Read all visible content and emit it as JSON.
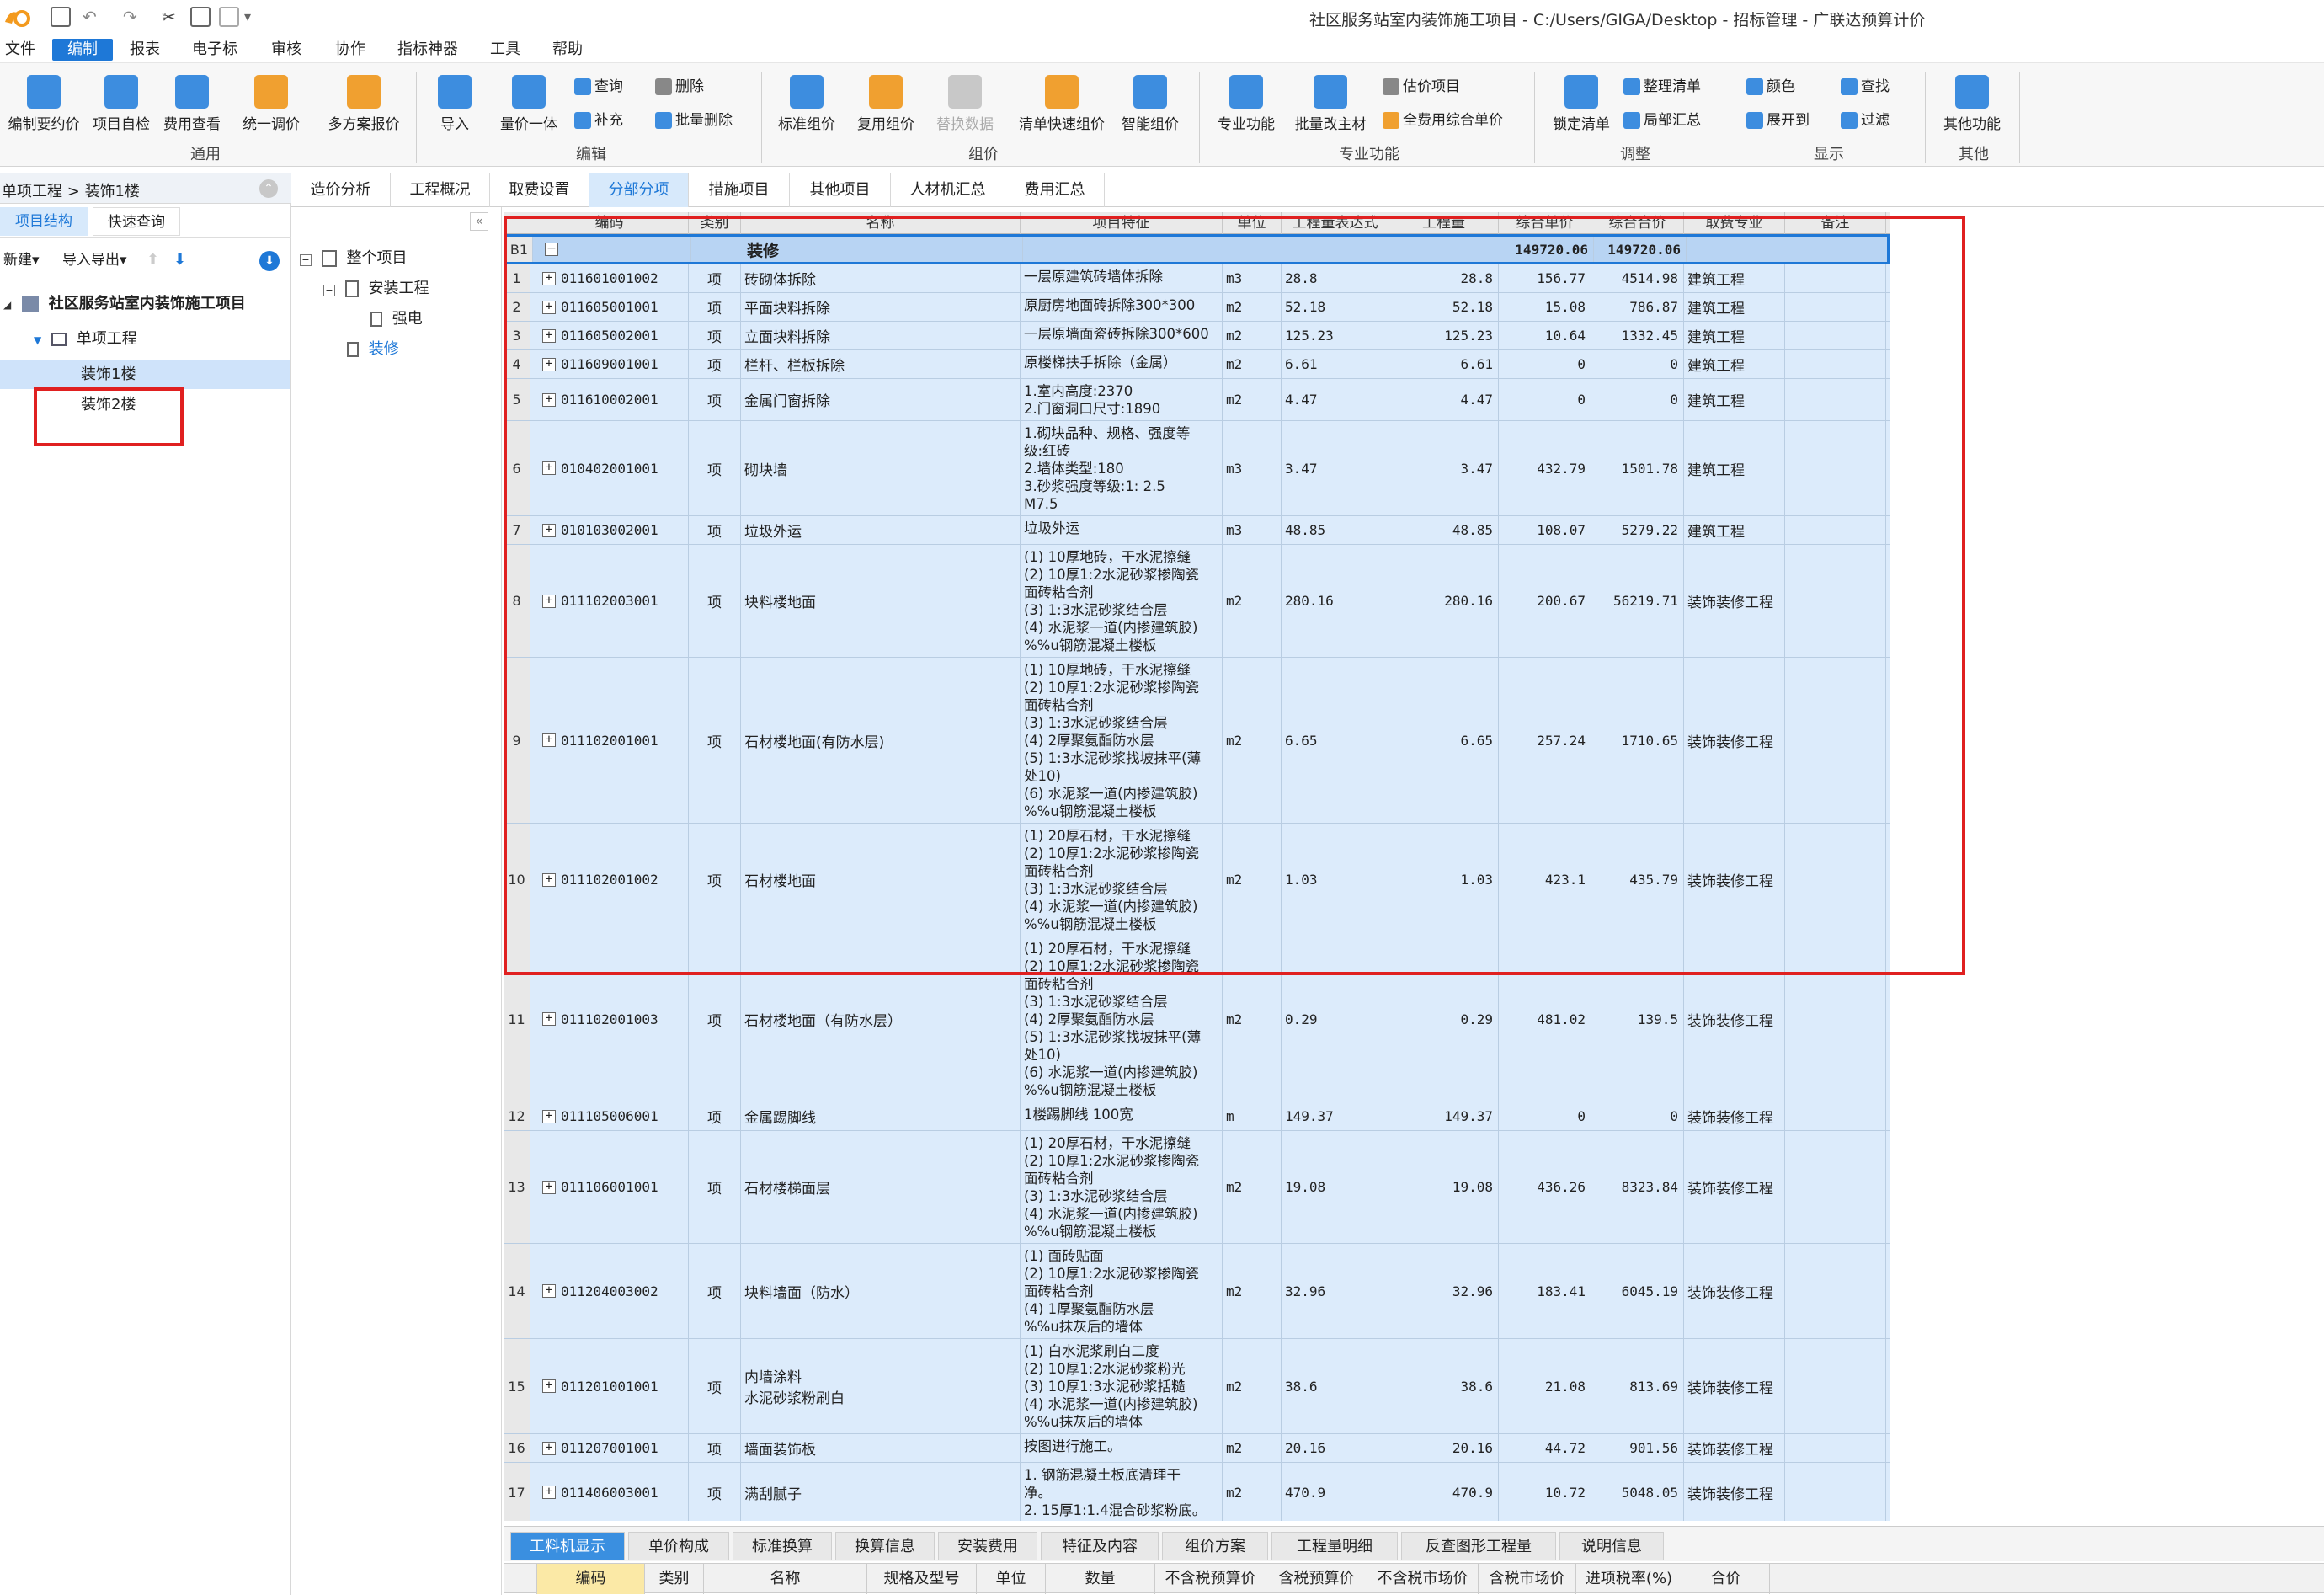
{
  "window": {
    "title": "社区服务站室内装饰施工项目 - C:/Users/GIGA/Desktop - 招标管理 - 广联达预算计价"
  },
  "menu": [
    "文件",
    "编制",
    "报表",
    "电子标",
    "审核",
    "协作",
    "指标神器",
    "工具",
    "帮助"
  ],
  "ribbon": {
    "general": {
      "label": "通用",
      "buttons": [
        "编制要约价",
        "项目自检",
        "费用查看",
        "统一调价",
        "多方案报价"
      ]
    },
    "edit": {
      "label": "编辑",
      "buttons": [
        "导入",
        "量价一体"
      ],
      "small": [
        "查询",
        "补充",
        "删除",
        "批量删除"
      ]
    },
    "group": {
      "label": "组价",
      "buttons": [
        "标准组价",
        "复用组价",
        "替换数据",
        "清单快速组价",
        "智能组价"
      ]
    },
    "pro": {
      "label": "专业功能",
      "buttons": [
        "专业功能",
        "批量改主材"
      ],
      "small": [
        "估价项目",
        "全费用综合单价"
      ]
    },
    "adjust": {
      "label": "调整",
      "buttons": [
        "锁定清单"
      ],
      "small": [
        "整理清单",
        "局部汇总"
      ]
    },
    "display": {
      "label": "显示",
      "small": [
        "颜色",
        "查找",
        "展开到",
        "过滤"
      ]
    },
    "other": {
      "label": "其他",
      "buttons": [
        "其他功能"
      ]
    }
  },
  "breadcrumb": "单项工程 > 装饰1楼",
  "left_tabs": [
    "项目结构",
    "快速查询"
  ],
  "left_toolbar": {
    "new": "新建",
    "import_export": "导入导出"
  },
  "project_tree": {
    "root": "社区服务站室内装饰施工项目",
    "single": "单项工程",
    "items": [
      "装饰1楼",
      "装饰2楼"
    ]
  },
  "section_tree": {
    "root": "整个项目",
    "child": "安装工程",
    "leaf1": "强电",
    "leaf2": "装修"
  },
  "tabs": [
    "造价分析",
    "工程概况",
    "取费设置",
    "分部分项",
    "措施项目",
    "其他项目",
    "人材机汇总",
    "费用汇总"
  ],
  "grid": {
    "headers": [
      "编码",
      "类别",
      "名称",
      "项目特征",
      "单位",
      "工程量表达式",
      "工程量",
      "综合单价",
      "综合合价",
      "取费专业",
      "备注"
    ],
    "group_row": {
      "id": "B1",
      "name": "装修",
      "unit_price": "149720.06",
      "total": "149720.06"
    },
    "rows": [
      {
        "n": "1",
        "code": "011601001002",
        "type": "项",
        "name": "砖砌体拆除",
        "feature": "一层原建筑砖墙体拆除",
        "unit": "m3",
        "expr": "28.8",
        "qty": "28.8",
        "price": "156.77",
        "total": "4514.98",
        "spec": "建筑工程"
      },
      {
        "n": "2",
        "code": "011605001001",
        "type": "项",
        "name": "平面块料拆除",
        "feature": "原厨房地面砖拆除300*300",
        "unit": "m2",
        "expr": "52.18",
        "qty": "52.18",
        "price": "15.08",
        "total": "786.87",
        "spec": "建筑工程"
      },
      {
        "n": "3",
        "code": "011605002001",
        "type": "项",
        "name": "立面块料拆除",
        "feature": "一层原墙面瓷砖拆除300*600",
        "unit": "m2",
        "expr": "125.23",
        "qty": "125.23",
        "price": "10.64",
        "total": "1332.45",
        "spec": "建筑工程"
      },
      {
        "n": "4",
        "code": "011609001001",
        "type": "项",
        "name": "栏杆、栏板拆除",
        "feature": "原楼梯扶手拆除（金属）",
        "unit": "m2",
        "expr": "6.61",
        "qty": "6.61",
        "price": "0",
        "total": "0",
        "spec": "建筑工程"
      },
      {
        "n": "5",
        "code": "011610002001",
        "type": "项",
        "name": "金属门窗拆除",
        "feature": "1.室内高度:2370\n2.门窗洞口尺寸:1890",
        "unit": "m2",
        "expr": "4.47",
        "qty": "4.47",
        "price": "0",
        "total": "0",
        "spec": "建筑工程"
      },
      {
        "n": "6",
        "code": "010402001001",
        "type": "项",
        "name": "砌块墙",
        "feature": "1.砌块品种、规格、强度等\n级:红砖\n2.墙体类型:180\n3.砂浆强度等级:1: 2.5\nM7.5",
        "unit": "m3",
        "expr": "3.47",
        "qty": "3.47",
        "price": "432.79",
        "total": "1501.78",
        "spec": "建筑工程"
      },
      {
        "n": "7",
        "code": "010103002001",
        "type": "项",
        "name": "垃圾外运",
        "feature": "垃圾外运",
        "unit": "m3",
        "expr": "48.85",
        "qty": "48.85",
        "price": "108.07",
        "total": "5279.22",
        "spec": "建筑工程"
      },
      {
        "n": "8",
        "code": "011102003001",
        "type": "项",
        "name": "块料楼地面",
        "feature": "(1) 10厚地砖，干水泥擦缝\n(2) 10厚1:2水泥砂浆掺陶瓷\n面砖粘合剂\n(3) 1:3水泥砂浆结合层\n(4) 水泥浆一道(内掺建筑胶)\n%%u钢筋混凝土楼板",
        "unit": "m2",
        "expr": "280.16",
        "qty": "280.16",
        "price": "200.67",
        "total": "56219.71",
        "spec": "装饰装修工程"
      },
      {
        "n": "9",
        "code": "011102001001",
        "type": "项",
        "name": "石材楼地面(有防水层)",
        "feature": "(1) 10厚地砖，干水泥擦缝\n(2) 10厚1:2水泥砂浆掺陶瓷\n面砖粘合剂\n(3) 1:3水泥砂浆结合层\n(4) 2厚聚氨酯防水层\n(5) 1:3水泥砂浆找坡抹平(薄\n处10)\n(6) 水泥浆一道(内掺建筑胶)\n%%u钢筋混凝土楼板",
        "unit": "m2",
        "expr": "6.65",
        "qty": "6.65",
        "price": "257.24",
        "total": "1710.65",
        "spec": "装饰装修工程"
      },
      {
        "n": "10",
        "code": "011102001002",
        "type": "项",
        "name": "石材楼地面",
        "feature": "(1) 20厚石材，干水泥擦缝\n(2) 10厚1:2水泥砂浆掺陶瓷\n面砖粘合剂\n(3) 1:3水泥砂浆结合层\n(4) 水泥浆一道(内掺建筑胶)\n%%u钢筋混凝土楼板",
        "unit": "m2",
        "expr": "1.03",
        "qty": "1.03",
        "price": "423.1",
        "total": "435.79",
        "spec": "装饰装修工程"
      },
      {
        "n": "11",
        "code": "011102001003",
        "type": "项",
        "name": "石材楼地面（有防水层）",
        "feature": "(1) 20厚石材，干水泥擦缝\n(2) 10厚1:2水泥砂浆掺陶瓷\n面砖粘合剂\n(3) 1:3水泥砂浆结合层\n(4) 2厚聚氨酯防水层\n(5) 1:3水泥砂浆找坡抹平(薄\n处10)\n(6) 水泥浆一道(内掺建筑胶)\n%%u钢筋混凝土楼板",
        "unit": "m2",
        "expr": "0.29",
        "qty": "0.29",
        "price": "481.02",
        "total": "139.5",
        "spec": "装饰装修工程"
      },
      {
        "n": "12",
        "code": "011105006001",
        "type": "项",
        "name": "金属踢脚线",
        "feature": "1楼踢脚线 100宽",
        "unit": "m",
        "expr": "149.37",
        "qty": "149.37",
        "price": "0",
        "total": "0",
        "spec": "装饰装修工程"
      },
      {
        "n": "13",
        "code": "011106001001",
        "type": "项",
        "name": "石材楼梯面层",
        "feature": "(1) 20厚石材，干水泥擦缝\n(2) 10厚1:2水泥砂浆掺陶瓷\n面砖粘合剂\n(3) 1:3水泥砂浆结合层\n(4) 水泥浆一道(内掺建筑胶)\n%%u钢筋混凝土楼板",
        "unit": "m2",
        "expr": "19.08",
        "qty": "19.08",
        "price": "436.26",
        "total": "8323.84",
        "spec": "装饰装修工程"
      },
      {
        "n": "14",
        "code": "011204003002",
        "type": "项",
        "name": "块料墙面（防水）",
        "feature": "(1) 面砖贴面\n(2) 10厚1:2水泥砂浆掺陶瓷\n面砖粘合剂\n(4) 1厚聚氨酯防水层\n%%u抹灰后的墙体",
        "unit": "m2",
        "expr": "32.96",
        "qty": "32.96",
        "price": "183.41",
        "total": "6045.19",
        "spec": "装饰装修工程"
      },
      {
        "n": "15",
        "code": "011201001001",
        "type": "项",
        "name": "内墙涂料\n水泥砂浆粉刷白",
        "feature": "(1) 白水泥浆刷白二度\n(2) 10厚1:2水泥砂浆粉光\n(3) 10厚1:3水泥砂浆括糙\n(4) 水泥浆一道(内掺建筑胶)\n%%u抹灰后的墙体",
        "unit": "m2",
        "expr": "38.6",
        "qty": "38.6",
        "price": "21.08",
        "total": "813.69",
        "spec": "装饰装修工程"
      },
      {
        "n": "16",
        "code": "011207001001",
        "type": "项",
        "name": "墙面装饰板",
        "feature": "按图进行施工。",
        "unit": "m2",
        "expr": "20.16",
        "qty": "20.16",
        "price": "44.72",
        "total": "901.56",
        "spec": "装饰装修工程"
      },
      {
        "n": "17",
        "code": "011406003001",
        "type": "项",
        "name": "满刮腻子",
        "feature": "1. 钢筋混凝土板底清理干\n净。\n2. 15厚1:1.4混合砂浆粉底。",
        "unit": "m2",
        "expr": "470.9",
        "qty": "470.9",
        "price": "10.72",
        "total": "5048.05",
        "spec": "装饰装修工程"
      }
    ]
  },
  "bottom_tabs": [
    "工料机显示",
    "单价构成",
    "标准换算",
    "换算信息",
    "安装费用",
    "特征及内容",
    "组价方案",
    "工程量明细",
    "反查图形工程量",
    "说明信息"
  ],
  "bottom_headers": [
    "编码",
    "类别",
    "名称",
    "规格及型号",
    "单位",
    "数量",
    "不含税预算价",
    "含税预算价",
    "不含税市场价",
    "含税市场价",
    "进项税率(%)",
    "合价"
  ],
  "colors": {
    "accent": "#1e78d7",
    "grid_bg": "#dcebfb",
    "highlight_border": "#e02020"
  }
}
